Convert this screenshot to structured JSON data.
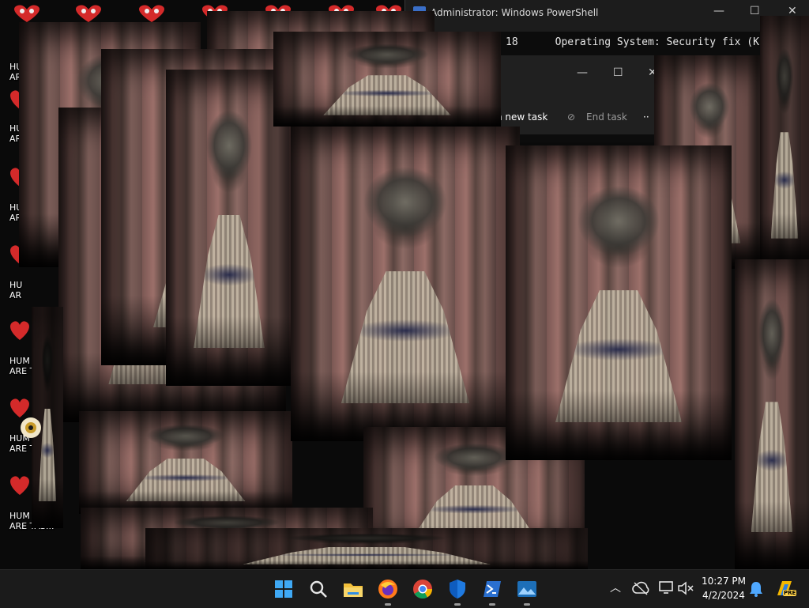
{
  "powershell": {
    "title": "Administrator: Windows PowerShell",
    "output_line": "18      Operating System: Security fix (K"
  },
  "task_manager": {
    "run_new_task": "n new task",
    "end_task": "End task",
    "more": "··"
  },
  "desktop_icons": [
    {
      "label_line1": "HU",
      "label_line2": "AR"
    },
    {
      "label_line1": "HU",
      "label_line2": "AR"
    },
    {
      "label_line1": "HU",
      "label_line2": "AR"
    },
    {
      "label_line1": "HU",
      "label_line2": "AR"
    },
    {
      "label_line1": "HUM",
      "label_line2": "ARE T"
    },
    {
      "label_line1": "HUM",
      "label_line2": "ARE T"
    },
    {
      "label_line1": "HUM",
      "label_line2": "ARE TAS..."
    }
  ],
  "taskbar": {
    "apps": [
      "windows-start-icon",
      "search-icon",
      "file-explorer-icon",
      "firefox-icon",
      "chrome-icon",
      "windows-security-icon",
      "powershell-icon",
      "photos-icon"
    ],
    "time": "10:27 PM",
    "date": "4/2/2024",
    "copilot_badge": "PRE"
  },
  "colors": {
    "taskbar_bg": "#1b1b1b",
    "heart_red": "#d42a2a",
    "accent_blue": "#0a7ad8"
  }
}
